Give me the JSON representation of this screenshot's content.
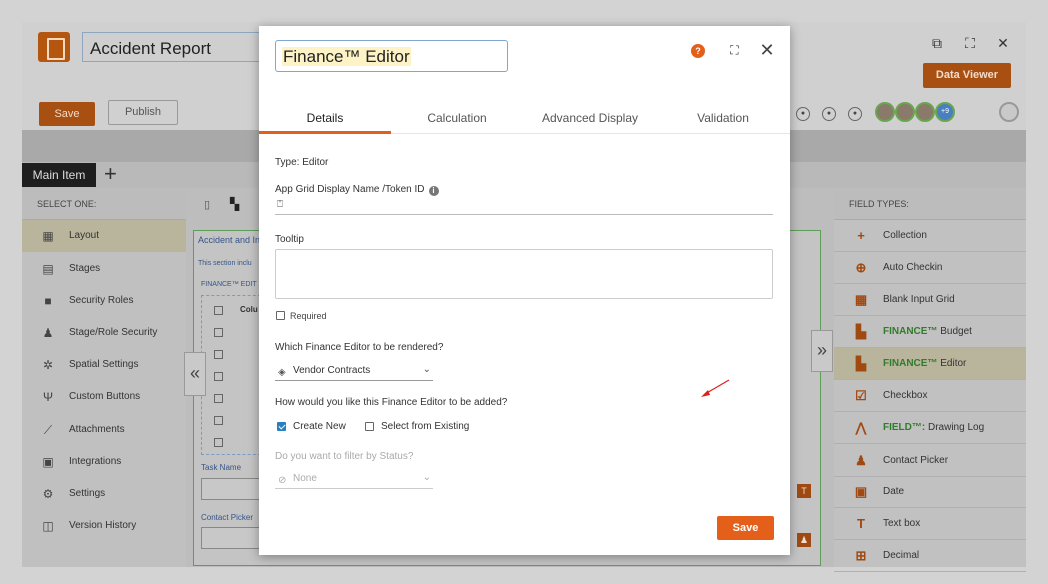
{
  "app": {
    "title": "Accident Report",
    "save_label": "Save",
    "publish_label": "Publish",
    "data_viewer_label": "Data Viewer",
    "main_tab_label": "Main Item",
    "avatar_badge": "+9"
  },
  "left_panel": {
    "header": "SELECT ONE:",
    "items": [
      {
        "label": "Layout",
        "icon": "layout-icon"
      },
      {
        "label": "Stages",
        "icon": "document-icon"
      },
      {
        "label": "Security Roles",
        "icon": "lock-icon"
      },
      {
        "label": "Stage/Role Security",
        "icon": "user-lock-icon"
      },
      {
        "label": "Spatial Settings",
        "icon": "spatial-gear-icon"
      },
      {
        "label": "Custom Buttons",
        "icon": "wrench-icon"
      },
      {
        "label": "Attachments",
        "icon": "paperclip-icon"
      },
      {
        "label": "Integrations",
        "icon": "integrations-icon"
      },
      {
        "label": "Settings",
        "icon": "gears-icon"
      },
      {
        "label": "Version History",
        "icon": "history-icon"
      }
    ]
  },
  "canvas": {
    "section_title": "Accident and In",
    "section_desc": "This section inclu",
    "finance_label": "FINANCE™ EDIT",
    "column_header": "Colu",
    "task_name_label": "Task Name",
    "contact_picker_label": "Contact Picker"
  },
  "right_panel": {
    "header": "FIELD TYPES:",
    "items": [
      {
        "label": "Collection",
        "icon": "plus-icon"
      },
      {
        "label": "Auto Checkin",
        "icon": "crosshair-icon"
      },
      {
        "label": "Blank Input Grid",
        "icon": "grid-icon"
      },
      {
        "prefix": "FINANCE™",
        "label": "Budget",
        "icon": "finance-doc-icon"
      },
      {
        "prefix": "FINANCE™",
        "label": "Editor",
        "icon": "finance-doc-icon"
      },
      {
        "label": "Checkbox",
        "icon": "checkbox-icon"
      },
      {
        "prefix": "FIELD™:",
        "label": "Drawing Log",
        "icon": "compass-icon"
      },
      {
        "label": "Contact Picker",
        "icon": "contact-icon"
      },
      {
        "label": "Date",
        "icon": "calendar-icon"
      },
      {
        "label": "Text box",
        "icon": "textbox-icon"
      },
      {
        "label": "Decimal",
        "icon": "decimal-icon"
      }
    ]
  },
  "modal": {
    "title": "Finance™ Editor",
    "tabs": [
      "Details",
      "Calculation",
      "Advanced Display",
      "Validation"
    ],
    "type_text": "Type: Editor",
    "display_name_label": "App Grid Display Name /Token ID",
    "display_name_value": "",
    "tooltip_label": "Tooltip",
    "required_label": "Required",
    "render_question": "Which Finance Editor to be rendered?",
    "render_value": "Vendor Contracts",
    "added_question": "How would you like this Finance Editor to be added?",
    "create_new_label": "Create New",
    "select_existing_label": "Select from Existing",
    "filter_question": "Do you want to filter by Status?",
    "filter_value": "None",
    "save_label": "Save"
  },
  "colors": {
    "accent": "#e4601a",
    "primary_blue": "#2a7fbe",
    "active_tab_underline": "#e4601a"
  }
}
